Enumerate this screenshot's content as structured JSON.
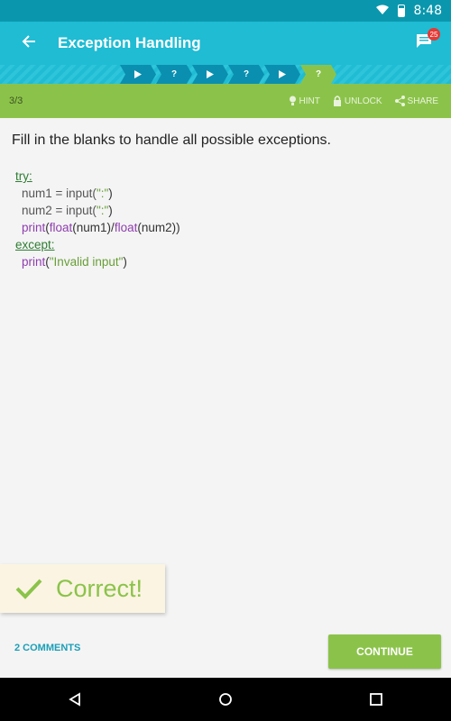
{
  "status": {
    "time": "8:48"
  },
  "appbar": {
    "title": "Exception Handling",
    "badge_count": "25"
  },
  "progress": {
    "steps": [
      "",
      "?",
      "",
      "?",
      "",
      "?"
    ]
  },
  "toolbar": {
    "counter": "3/3",
    "hint": "HINT",
    "unlock": "UNLOCK",
    "share": "SHARE"
  },
  "question": "Fill in the blanks to handle all possible exceptions.",
  "code": {
    "try": "try:",
    "l1a": "num1 = input(",
    "l1s": "\":\"",
    "l1b": ")",
    "l2a": "num2 = input(",
    "l2s": "\":\"",
    "l2b": ")",
    "l3f1": "print",
    "l3p1": "(",
    "l3f2": "float",
    "l3p2": "(num1)/",
    "l3f3": "float",
    "l3p3": "(num2))",
    "except": "except:",
    "l5f": "print",
    "l5p1": "(",
    "l5s": "\"Invalid input\"",
    "l5p2": ")"
  },
  "feedback": {
    "label": "Correct!"
  },
  "footer": {
    "comments": "2 COMMENTS",
    "continue": "CONTINUE"
  },
  "colors": {
    "primary": "#1fbcd3",
    "accent": "#8bc34a",
    "dark": "#0a97ad"
  }
}
